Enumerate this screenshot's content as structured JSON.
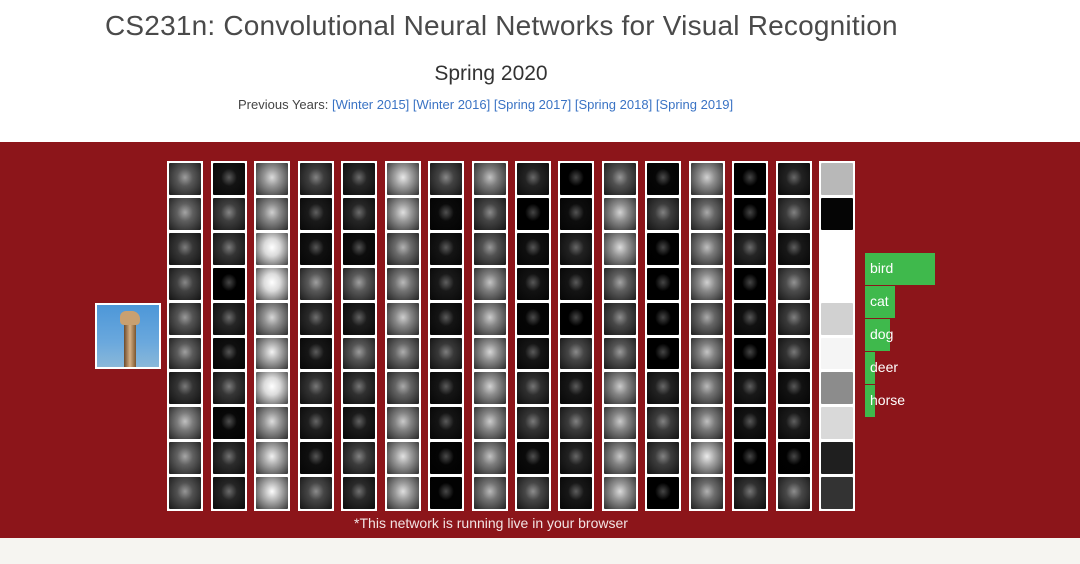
{
  "header": {
    "title": "CS231n: Convolutional Neural Networks for Visual Recognition",
    "subtitle": "Spring 2020",
    "previous_label": "Previous Years:",
    "previous_years": [
      "[Winter 2015]",
      "[Winter 2016]",
      "[Spring 2017]",
      "[Spring 2018]",
      "[Spring 2019]"
    ]
  },
  "demo": {
    "note": "*This network is running live in your browser",
    "predictions": [
      {
        "label": "bird",
        "prob": 0.7
      },
      {
        "label": "cat",
        "prob": 0.3
      },
      {
        "label": "dog",
        "prob": 0.25
      },
      {
        "label": "deer",
        "prob": 0.08
      },
      {
        "label": "horse",
        "prob": 0.08
      }
    ],
    "colors": {
      "background": "#8c151a",
      "bar": "#3fb94c",
      "link": "#3a73c4"
    }
  }
}
